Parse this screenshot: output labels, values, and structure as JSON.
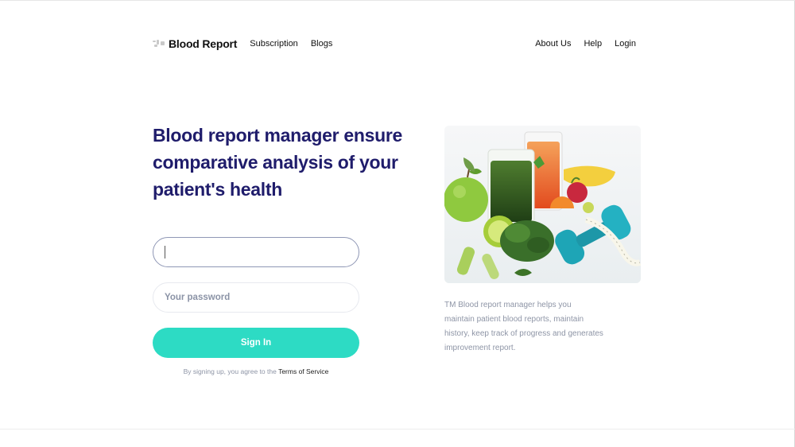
{
  "nav": {
    "brand_name": "Blood Report",
    "left_links": [
      "Subscription",
      "Blogs"
    ],
    "right_links": [
      "About Us",
      "Help",
      "Login"
    ]
  },
  "hero": {
    "title": "Blood report manager ensure comparative analysis of your patient's health",
    "email_value": "",
    "password_placeholder": "Your password",
    "signin_label": "Sign In",
    "terms_prefix": "By signing up, you agree to the",
    "terms_link": "Terms of Service",
    "description": "TM Blood report manager helps you maintain patient blood reports, maintain history, keep track of progress and generates improvement report."
  },
  "image": {
    "icon": "healthy-food-dumbbell-illustration"
  },
  "colors": {
    "title": "#1f1c6b",
    "button": "#2ddbc4",
    "muted_text": "#8e95a6"
  }
}
